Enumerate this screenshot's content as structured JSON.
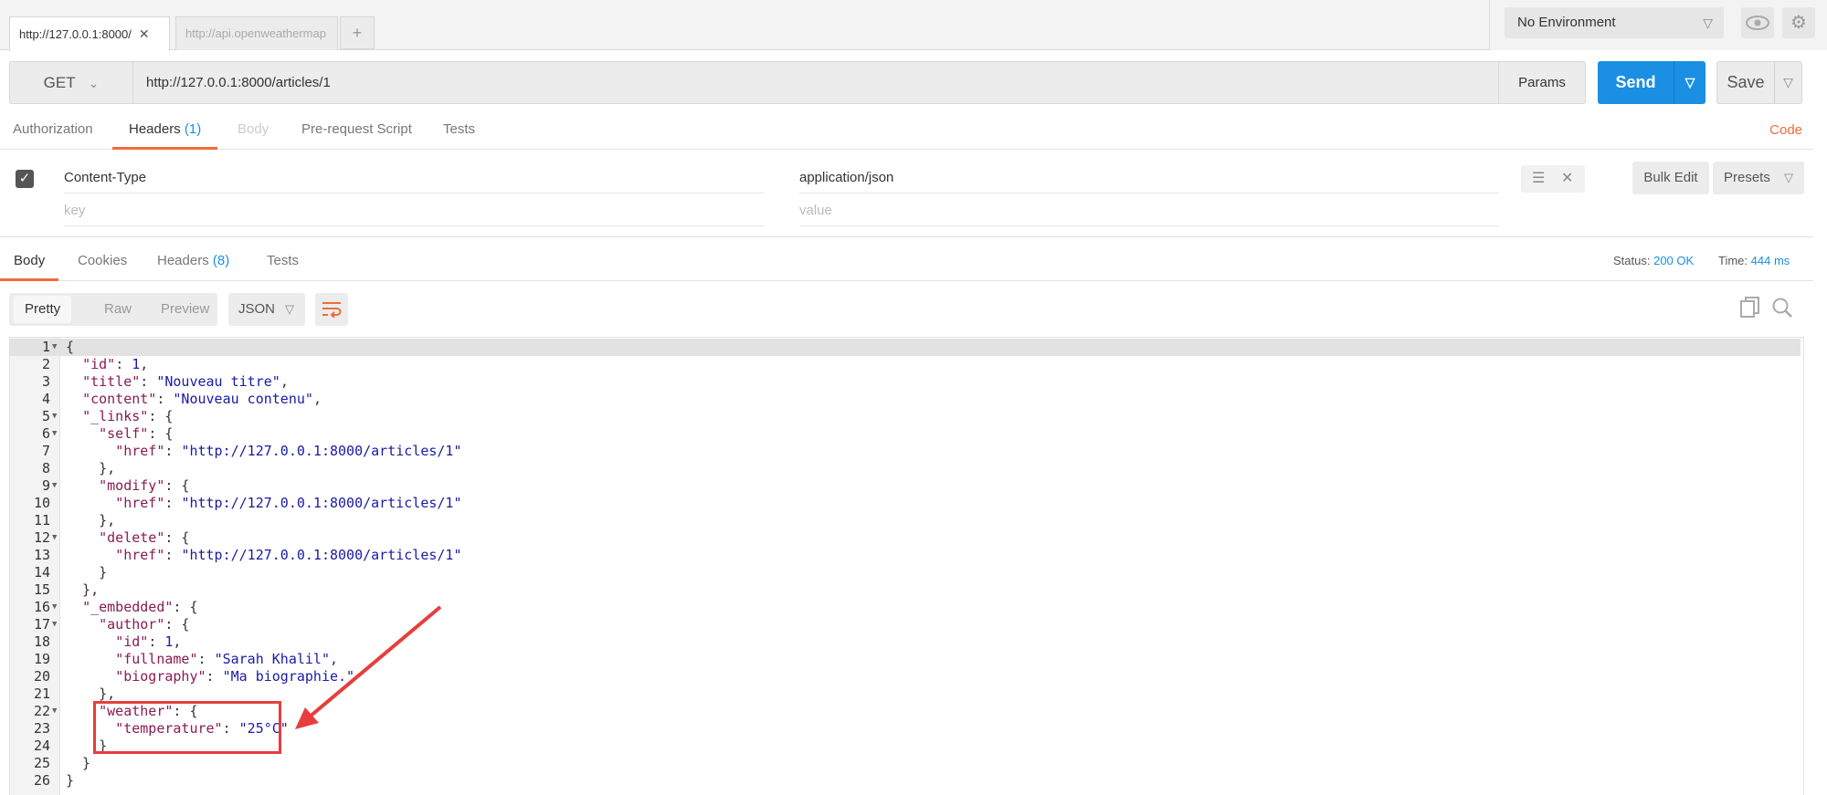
{
  "tabs": [
    {
      "label": "http://127.0.0.1:8000/",
      "close": "✕",
      "active": true
    },
    {
      "label": "http://api.openweathermap",
      "active": false
    }
  ],
  "add_tab": "+",
  "environment": {
    "selected": "No Environment",
    "chevron": "⌄"
  },
  "request": {
    "method": "GET",
    "url": "http://127.0.0.1:8000/articles/1",
    "params_label": "Params",
    "send_label": "Send",
    "save_label": "Save"
  },
  "request_tabs": [
    {
      "label": "Authorization"
    },
    {
      "label": "Headers",
      "count": "(1)"
    },
    {
      "label": "Body"
    },
    {
      "label": "Pre-request Script"
    },
    {
      "label": "Tests"
    }
  ],
  "code_link": "Code",
  "headers": {
    "rows": [
      {
        "key": "Content-Type",
        "value": "application/json",
        "checked": true
      }
    ],
    "key_placeholder": "key",
    "value_placeholder": "value",
    "bulk_edit": "Bulk Edit",
    "presets": "Presets"
  },
  "response_tabs": [
    {
      "label": "Body"
    },
    {
      "label": "Cookies"
    },
    {
      "label": "Headers",
      "count": "(8)"
    },
    {
      "label": "Tests"
    }
  ],
  "status": {
    "label": "Status:",
    "value": "200 OK",
    "time_label": "Time:",
    "time_value": "444 ms"
  },
  "view_modes": [
    "Pretty",
    "Raw",
    "Preview"
  ],
  "format": "JSON",
  "icons": {
    "wrap": "wrap-lines-icon",
    "copy": "copy-icon",
    "search": "search-icon",
    "eye": "eye-icon",
    "gear": "gear-icon"
  },
  "colors": {
    "accent": "#f26b3a",
    "send": "#1a8fe3",
    "annotation": "#e83d3d"
  }
}
